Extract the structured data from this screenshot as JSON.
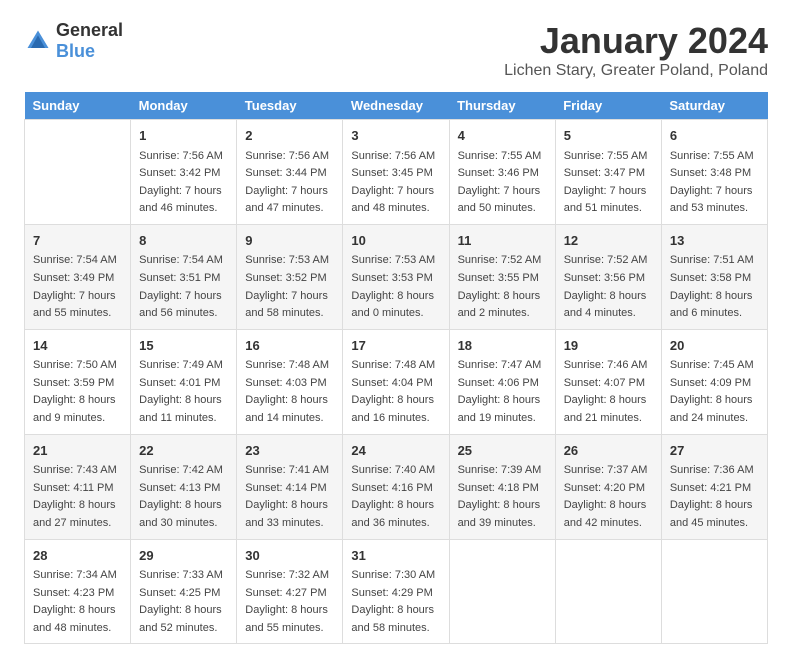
{
  "logo": {
    "text_general": "General",
    "text_blue": "Blue"
  },
  "title": "January 2024",
  "subtitle": "Lichen Stary, Greater Poland, Poland",
  "header_days": [
    "Sunday",
    "Monday",
    "Tuesday",
    "Wednesday",
    "Thursday",
    "Friday",
    "Saturday"
  ],
  "weeks": [
    {
      "days": [
        {
          "num": "",
          "content": ""
        },
        {
          "num": "1",
          "content": "Sunrise: 7:56 AM\nSunset: 3:42 PM\nDaylight: 7 hours\nand 46 minutes."
        },
        {
          "num": "2",
          "content": "Sunrise: 7:56 AM\nSunset: 3:44 PM\nDaylight: 7 hours\nand 47 minutes."
        },
        {
          "num": "3",
          "content": "Sunrise: 7:56 AM\nSunset: 3:45 PM\nDaylight: 7 hours\nand 48 minutes."
        },
        {
          "num": "4",
          "content": "Sunrise: 7:55 AM\nSunset: 3:46 PM\nDaylight: 7 hours\nand 50 minutes."
        },
        {
          "num": "5",
          "content": "Sunrise: 7:55 AM\nSunset: 3:47 PM\nDaylight: 7 hours\nand 51 minutes."
        },
        {
          "num": "6",
          "content": "Sunrise: 7:55 AM\nSunset: 3:48 PM\nDaylight: 7 hours\nand 53 minutes."
        }
      ]
    },
    {
      "days": [
        {
          "num": "7",
          "content": "Sunrise: 7:54 AM\nSunset: 3:49 PM\nDaylight: 7 hours\nand 55 minutes."
        },
        {
          "num": "8",
          "content": "Sunrise: 7:54 AM\nSunset: 3:51 PM\nDaylight: 7 hours\nand 56 minutes."
        },
        {
          "num": "9",
          "content": "Sunrise: 7:53 AM\nSunset: 3:52 PM\nDaylight: 7 hours\nand 58 minutes."
        },
        {
          "num": "10",
          "content": "Sunrise: 7:53 AM\nSunset: 3:53 PM\nDaylight: 8 hours\nand 0 minutes."
        },
        {
          "num": "11",
          "content": "Sunrise: 7:52 AM\nSunset: 3:55 PM\nDaylight: 8 hours\nand 2 minutes."
        },
        {
          "num": "12",
          "content": "Sunrise: 7:52 AM\nSunset: 3:56 PM\nDaylight: 8 hours\nand 4 minutes."
        },
        {
          "num": "13",
          "content": "Sunrise: 7:51 AM\nSunset: 3:58 PM\nDaylight: 8 hours\nand 6 minutes."
        }
      ]
    },
    {
      "days": [
        {
          "num": "14",
          "content": "Sunrise: 7:50 AM\nSunset: 3:59 PM\nDaylight: 8 hours\nand 9 minutes."
        },
        {
          "num": "15",
          "content": "Sunrise: 7:49 AM\nSunset: 4:01 PM\nDaylight: 8 hours\nand 11 minutes."
        },
        {
          "num": "16",
          "content": "Sunrise: 7:48 AM\nSunset: 4:03 PM\nDaylight: 8 hours\nand 14 minutes."
        },
        {
          "num": "17",
          "content": "Sunrise: 7:48 AM\nSunset: 4:04 PM\nDaylight: 8 hours\nand 16 minutes."
        },
        {
          "num": "18",
          "content": "Sunrise: 7:47 AM\nSunset: 4:06 PM\nDaylight: 8 hours\nand 19 minutes."
        },
        {
          "num": "19",
          "content": "Sunrise: 7:46 AM\nSunset: 4:07 PM\nDaylight: 8 hours\nand 21 minutes."
        },
        {
          "num": "20",
          "content": "Sunrise: 7:45 AM\nSunset: 4:09 PM\nDaylight: 8 hours\nand 24 minutes."
        }
      ]
    },
    {
      "days": [
        {
          "num": "21",
          "content": "Sunrise: 7:43 AM\nSunset: 4:11 PM\nDaylight: 8 hours\nand 27 minutes."
        },
        {
          "num": "22",
          "content": "Sunrise: 7:42 AM\nSunset: 4:13 PM\nDaylight: 8 hours\nand 30 minutes."
        },
        {
          "num": "23",
          "content": "Sunrise: 7:41 AM\nSunset: 4:14 PM\nDaylight: 8 hours\nand 33 minutes."
        },
        {
          "num": "24",
          "content": "Sunrise: 7:40 AM\nSunset: 4:16 PM\nDaylight: 8 hours\nand 36 minutes."
        },
        {
          "num": "25",
          "content": "Sunrise: 7:39 AM\nSunset: 4:18 PM\nDaylight: 8 hours\nand 39 minutes."
        },
        {
          "num": "26",
          "content": "Sunrise: 7:37 AM\nSunset: 4:20 PM\nDaylight: 8 hours\nand 42 minutes."
        },
        {
          "num": "27",
          "content": "Sunrise: 7:36 AM\nSunset: 4:21 PM\nDaylight: 8 hours\nand 45 minutes."
        }
      ]
    },
    {
      "days": [
        {
          "num": "28",
          "content": "Sunrise: 7:34 AM\nSunset: 4:23 PM\nDaylight: 8 hours\nand 48 minutes."
        },
        {
          "num": "29",
          "content": "Sunrise: 7:33 AM\nSunset: 4:25 PM\nDaylight: 8 hours\nand 52 minutes."
        },
        {
          "num": "30",
          "content": "Sunrise: 7:32 AM\nSunset: 4:27 PM\nDaylight: 8 hours\nand 55 minutes."
        },
        {
          "num": "31",
          "content": "Sunrise: 7:30 AM\nSunset: 4:29 PM\nDaylight: 8 hours\nand 58 minutes."
        },
        {
          "num": "",
          "content": ""
        },
        {
          "num": "",
          "content": ""
        },
        {
          "num": "",
          "content": ""
        }
      ]
    }
  ]
}
